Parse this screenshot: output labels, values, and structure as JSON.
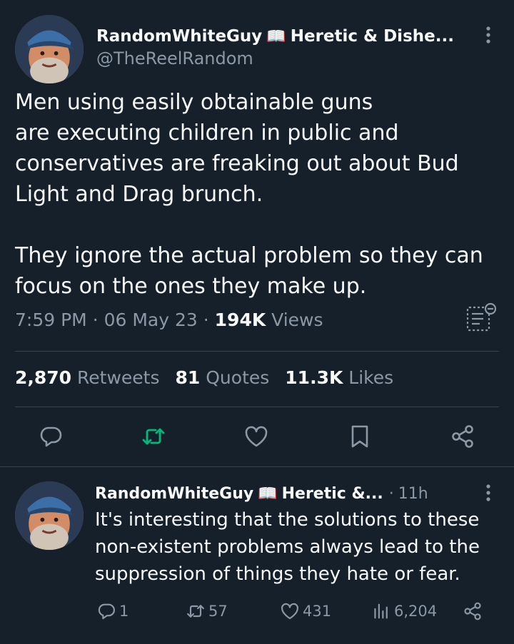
{
  "main_tweet": {
    "display_name": "RandomWhiteGuy",
    "name_emoji": "📖",
    "name_suffix": "Heretic & Dishe...",
    "handle": "@TheReelRandom",
    "text": "Men using easily obtainable guns\nare executing children in public and\nconservatives are freaking out about Bud\nLight and Drag brunch.\n\nThey ignore the actual problem so they can\nfocus on the ones they make up.",
    "time": "7:59 PM",
    "date": "06 May 23",
    "views_count": "194K",
    "views_label": "Views",
    "retweets_count": "2,870",
    "retweets_label": "Retweets",
    "quotes_count": "81",
    "quotes_label": "Quotes",
    "likes_count": "11.3K",
    "likes_label": "Likes"
  },
  "reply": {
    "display_name": "RandomWhiteGuy",
    "name_emoji": "📖",
    "name_suffix": "Heretic &...",
    "age": "11h",
    "text": "It's interesting that the solutions to these non-existent problems always lead to the suppression of things they hate or fear.",
    "replies": "1",
    "retweets": "57",
    "likes": "431",
    "views": "6,204"
  },
  "colors": {
    "background": "#15202b",
    "text": "#f7f9f9",
    "muted": "#8b98a5",
    "retweet_active": "#00ba7c",
    "divider": "#38444d"
  }
}
